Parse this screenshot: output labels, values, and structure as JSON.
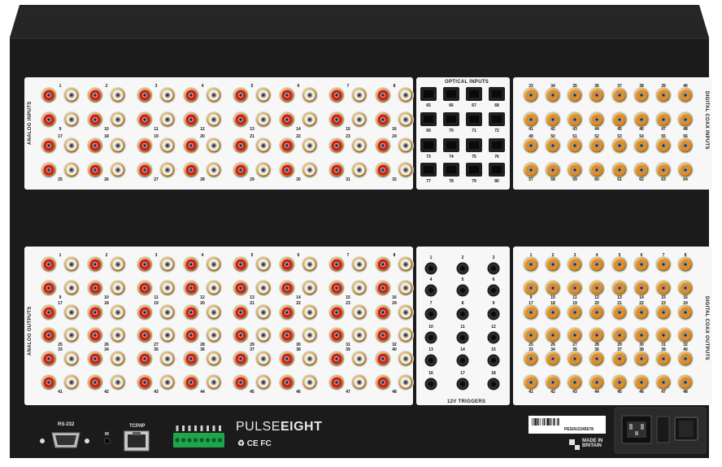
{
  "panels": {
    "analog_inputs": "ANALOG INPUTS",
    "optical_inputs": "OPTICAL INPUTS",
    "digital_coax_inputs": "DIGITAL COAX INPUTS",
    "analog_outputs": "ANALOG OUTPUTS",
    "triggers": "12V TRIGGERS",
    "digital_coax_outputs": "DIGITAL COAX OUTPUTS"
  },
  "ports": {
    "rs232": "RS-232",
    "ir": "IR",
    "tcpip": "TCP/IP"
  },
  "brand": {
    "pulse": "PULSE",
    "eight": "EIGHT",
    "certs": "♻ CE FC"
  },
  "label_sticker": {
    "serial": "PES0U2345678"
  },
  "made_in": {
    "line1": "MADE IN",
    "line2": "BRITAIN"
  },
  "colors": {
    "chassis": "#1a1a1a",
    "panel": "#f7f7f7",
    "analog_red": "#d8141b",
    "analog_white": "#eeeeee",
    "coax_orange": "#e8891f",
    "terminal_green": "#1fa64b"
  }
}
